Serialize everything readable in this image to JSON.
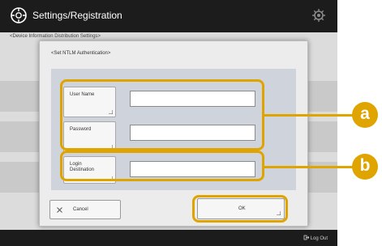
{
  "window": {
    "title": "Settings/Registration"
  },
  "background": {
    "breadcrumb": "<Device Information Distribution Settings>",
    "logout_label": "Log Out"
  },
  "dialog": {
    "title": "<Set NTLM Authentication>",
    "fields": [
      {
        "label": "User Name",
        "value": ""
      },
      {
        "label": "Password",
        "value": ""
      },
      {
        "label": "Login Destination",
        "value": ""
      }
    ],
    "cancel_label": "Cancel",
    "ok_label": "OK"
  },
  "callouts": [
    "a",
    "b"
  ],
  "colors": {
    "highlight": "#e0a400",
    "title_bar": "#1c1c1c",
    "panel": "#cfd4dc"
  }
}
